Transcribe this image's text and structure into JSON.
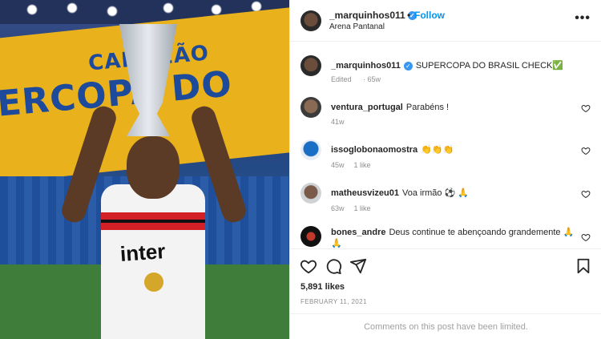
{
  "photo": {
    "banner_line1": "CAMPEÃO",
    "banner_line2": "ERCOPA DO",
    "jersey_sponsor": "inter"
  },
  "header": {
    "username": "_marquinhos011",
    "separator": "•",
    "follow_label": "Follow",
    "location": "Arena Pantanal",
    "more": "•••"
  },
  "caption": {
    "username": "_marquinhos011",
    "text": "SUPERCOPA DO BRASIL CHECK✅",
    "edited": "Edited",
    "time": "65w"
  },
  "comments": [
    {
      "username": "ventura_portugal",
      "text": "Parabéns !",
      "time": "41w",
      "likes": ""
    },
    {
      "username": "issoglobonaomostra",
      "text": "👏👏👏",
      "time": "45w",
      "likes": "1 like"
    },
    {
      "username": "matheusvizeu01",
      "text": "Voa irmão ⚽ 🙏",
      "time": "63w",
      "likes": "1 like"
    },
    {
      "username": "bones_andre",
      "text": "Deus continue te abençoando grandemente 🙏 🙏",
      "time": "",
      "likes": ""
    }
  ],
  "footer": {
    "likes": "5,891 likes",
    "date": "FEBRUARY 11, 2021",
    "limited": "Comments on this post have been limited."
  },
  "colors": {
    "link": "#0095f6",
    "verified": "#3897f0",
    "muted": "#8e8e8e"
  }
}
